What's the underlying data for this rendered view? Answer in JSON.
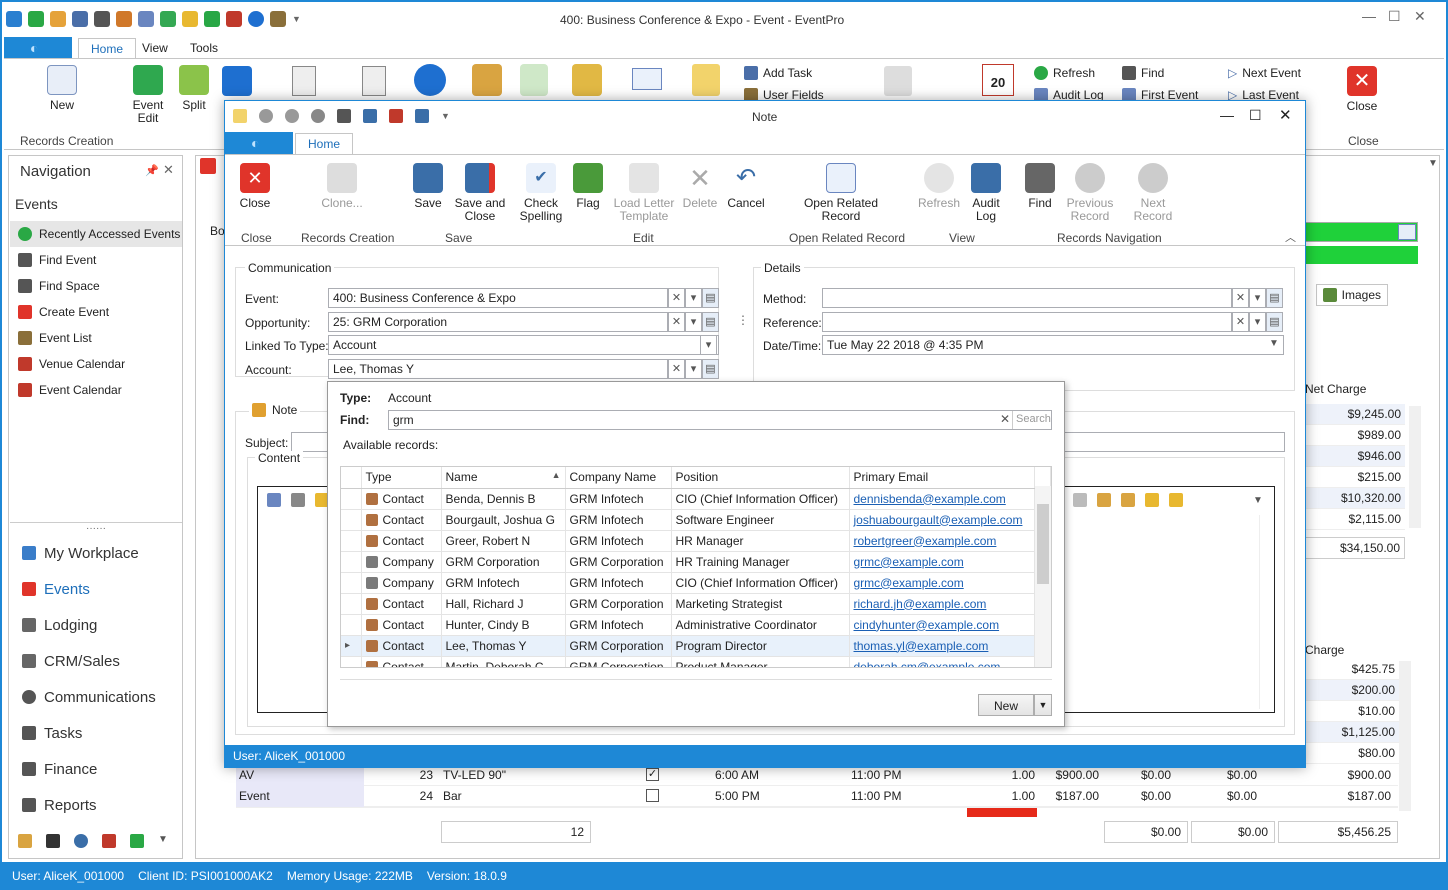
{
  "window": {
    "title": "400: Business Conference & Expo - Event - EventPro"
  },
  "main_tabs": [
    "Home",
    "View",
    "Tools"
  ],
  "ribbon": {
    "new": "New",
    "event_edit": "Event\nEdit",
    "split": "Split",
    "records_creation": "Records Creation",
    "add_task": "Add Task",
    "user_fields": "User Fields",
    "refresh": "Refresh",
    "audit_log": "Audit Log",
    "find": "Find",
    "first_event": "First Event",
    "next_event": "Next Event",
    "last_event": "Last Event",
    "close": "Close",
    "close_group": "Close",
    "calendar_day": "20"
  },
  "nav": {
    "title": "Navigation",
    "section": "Events",
    "items": [
      "Recently Accessed Events",
      "Find Event",
      "Find Space",
      "Create Event",
      "Event List",
      "Venue Calendar",
      "Event Calendar"
    ],
    "modules": [
      "My Workplace",
      "Events",
      "Lodging",
      "CRM/Sales",
      "Communications",
      "Tasks",
      "Finance",
      "Reports"
    ]
  },
  "background": {
    "net_charge": "Net Charge",
    "charge": "Charge",
    "images_tab": "Images",
    "bo_label": "Bo",
    "top_values": [
      "$9,245.00",
      "$989.00",
      "$946.00",
      "$215.00",
      "$10,320.00",
      "$2,115.00"
    ],
    "top_total": "$34,150.00",
    "bottom_values": [
      "$425.75",
      "$200.00",
      "$10.00",
      "$1,125.00",
      "$80.00"
    ],
    "rows": [
      {
        "cat": "AV",
        "num": "23",
        "item": "TV-LED 90\"",
        "checked": true,
        "start": "6:00 AM",
        "end": "11:00 PM",
        "qty": "1.00",
        "price": "$900.00",
        "d1": "$0.00",
        "d2": "$0.00",
        "total": "$900.00"
      },
      {
        "cat": "Event",
        "num": "24",
        "item": "Bar",
        "checked": false,
        "start": "5:00 PM",
        "end": "11:00 PM",
        "qty": "1.00",
        "price": "$187.00",
        "d1": "$0.00",
        "d2": "$0.00",
        "total": "$187.00"
      }
    ],
    "footer": {
      "count": "12",
      "d1": "$0.00",
      "d2": "$0.00",
      "total": "$5,456.25"
    }
  },
  "status": {
    "user": "User: AliceK_001000",
    "client": "Client ID: PSI001000AK2",
    "memory": "Memory Usage: 222MB",
    "version": "Version: 18.0.9"
  },
  "dialog": {
    "title": "Note",
    "tab": "Home",
    "ribbon": {
      "close": "Close",
      "clone": "Clone...",
      "save": "Save",
      "save_close": "Save and\nClose",
      "check_spelling": "Check\nSpelling",
      "flag": "Flag",
      "load_letter": "Load Letter\nTemplate",
      "delete": "Delete",
      "cancel": "Cancel",
      "open_related": "Open Related\nRecord",
      "refresh": "Refresh",
      "audit_log": "Audit\nLog",
      "find": "Find",
      "previous": "Previous\nRecord",
      "next": "Next Record",
      "groups": [
        "Close",
        "Records Creation",
        "Save",
        "Edit",
        "Open Related Record",
        "View",
        "Records Navigation"
      ]
    },
    "communication": {
      "legend": "Communication",
      "event_label": "Event:",
      "event": "400: Business Conference & Expo",
      "opp_label": "Opportunity:",
      "opp": "25: GRM Corporation",
      "linked_label": "Linked To Type:",
      "linked": "Account",
      "account_label": "Account:",
      "account": "Lee, Thomas Y"
    },
    "details": {
      "legend": "Details",
      "method_label": "Method:",
      "method": "",
      "ref_label": "Reference:",
      "ref": "",
      "date_label": "Date/Time:",
      "date": "Tue May 22 2018 @ 4:35 PM"
    },
    "note": {
      "legend": "Note",
      "subject_label": "Subject:",
      "content_label": "Content"
    },
    "user": "User: AliceK_001000"
  },
  "popup": {
    "type_label": "Type:",
    "type": "Account",
    "find_label": "Find:",
    "find_value": "grm",
    "search": "Search",
    "available": "Available records:",
    "columns": [
      "Type",
      "Name",
      "Company Name",
      "Position",
      "Primary Email"
    ],
    "rows": [
      {
        "type": "Contact",
        "name": "Benda, Dennis B",
        "company": "GRM Infotech",
        "position": "CIO (Chief Information Officer)",
        "email": "dennisbenda@example.com"
      },
      {
        "type": "Contact",
        "name": "Bourgault, Joshua G",
        "company": "GRM Infotech",
        "position": "Software Engineer",
        "email": "joshuabourgault@example.com"
      },
      {
        "type": "Contact",
        "name": "Greer, Robert N",
        "company": "GRM Infotech",
        "position": "HR Manager",
        "email": "robertgreer@example.com"
      },
      {
        "type": "Company",
        "name": "GRM Corporation",
        "company": "GRM Corporation",
        "position": "HR Training Manager",
        "email": "grmc@example.com"
      },
      {
        "type": "Company",
        "name": "GRM Infotech",
        "company": "GRM Infotech",
        "position": "CIO (Chief Information Officer)",
        "email": "grmc@example.com"
      },
      {
        "type": "Contact",
        "name": "Hall, Richard J",
        "company": "GRM Corporation",
        "position": "Marketing Strategist",
        "email": "richard.jh@example.com"
      },
      {
        "type": "Contact",
        "name": "Hunter, Cindy B",
        "company": "GRM Infotech",
        "position": "Administrative Coordinator",
        "email": "cindyhunter@example.com"
      },
      {
        "type": "Contact",
        "name": "Lee, Thomas Y",
        "company": "GRM Corporation",
        "position": "Program Director",
        "email": "thomas.yl@example.com"
      },
      {
        "type": "Contact",
        "name": "Martin, Deborah C",
        "company": "GRM Corporation",
        "position": "Product Manager",
        "email": "deborah.cm@example.com"
      }
    ],
    "new": "New"
  }
}
